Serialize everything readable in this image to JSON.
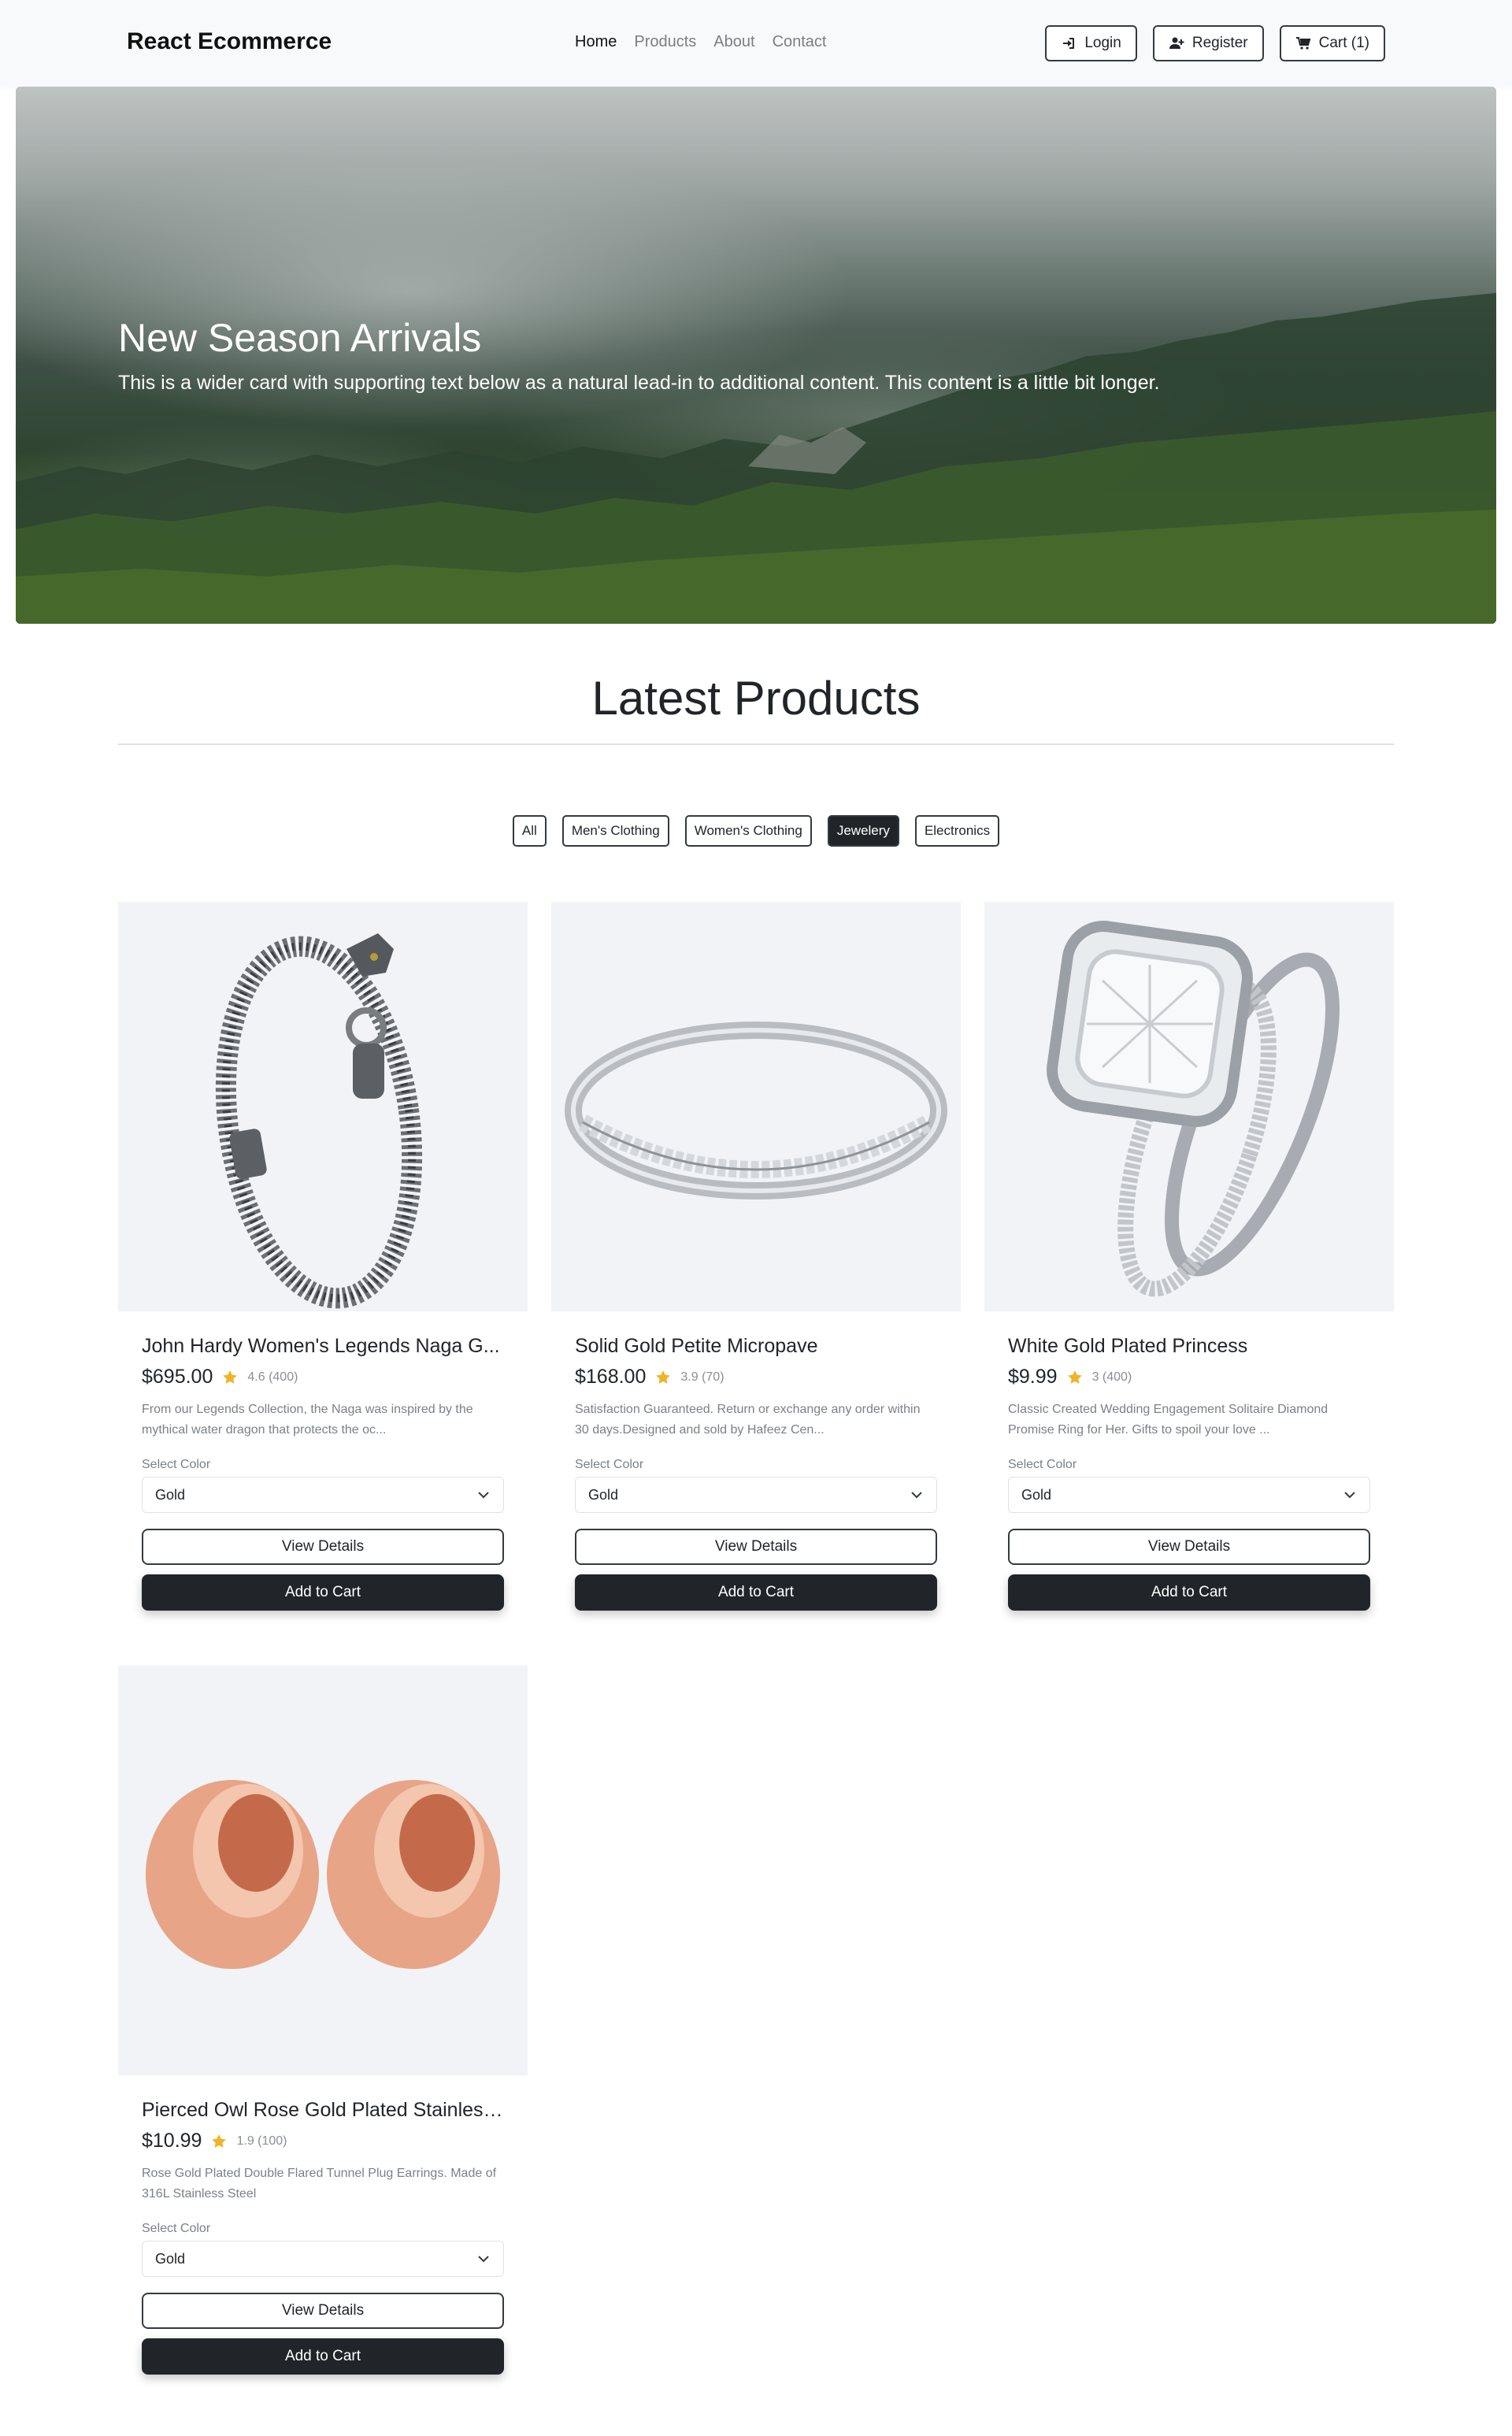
{
  "brand": "React Ecommerce",
  "nav": {
    "links": [
      "Home",
      "Products",
      "About",
      "Contact"
    ],
    "login": "Login",
    "register": "Register",
    "cart": "Cart (1)"
  },
  "hero": {
    "title": "New Season Arrivals",
    "text": "This is a wider card with supporting text below as a natural lead-in to additional content. This content is a little bit longer."
  },
  "section_title": "Latest Products",
  "filters": {
    "items": [
      "All",
      "Men's Clothing",
      "Women's Clothing",
      "Jewelery",
      "Electronics"
    ],
    "active": "Jewelery"
  },
  "products": [
    {
      "title": "John Hardy Women's Legends Naga G...",
      "price": "$695.00",
      "rating": "4.6 (400)",
      "description": "From our Legends Collection, the Naga was inspired by the mythical water dragon that protects the oc...",
      "select_label": "Select Color",
      "select_value": "Gold",
      "view_details": "View Details",
      "add_to_cart": "Add to Cart",
      "image_icon": "bracelet-image"
    },
    {
      "title": "Solid Gold Petite Micropave",
      "price": "$168.00",
      "rating": "3.9 (70)",
      "description": "Satisfaction Guaranteed. Return or exchange any order within 30 days.Designed and sold by Hafeez Cen...",
      "select_label": "Select Color",
      "select_value": "Gold",
      "view_details": "View Details",
      "add_to_cart": "Add to Cart",
      "image_icon": "ring-image"
    },
    {
      "title": "White Gold Plated Princess",
      "price": "$9.99",
      "rating": "3 (400)",
      "description": "Classic Created Wedding Engagement Solitaire Diamond Promise Ring for Her. Gifts to spoil your love ...",
      "select_label": "Select Color",
      "select_value": "Gold",
      "view_details": "View Details",
      "add_to_cart": "Add to Cart",
      "image_icon": "diamond-ring-image"
    },
    {
      "title": "Pierced Owl Rose Gold Plated Stainless...",
      "price": "$10.99",
      "rating": "1.9 (100)",
      "description": "Rose Gold Plated Double Flared Tunnel Plug Earrings. Made of 316L Stainless Steel",
      "select_label": "Select Color",
      "select_value": "Gold",
      "view_details": "View Details",
      "add_to_cart": "Add to Cart",
      "image_icon": "earrings-image"
    }
  ],
  "colors": {
    "dark": "#212529",
    "navbar_bg": "#f8f9fa",
    "star": "#f0b429",
    "rose_gold": "#d9876a"
  }
}
